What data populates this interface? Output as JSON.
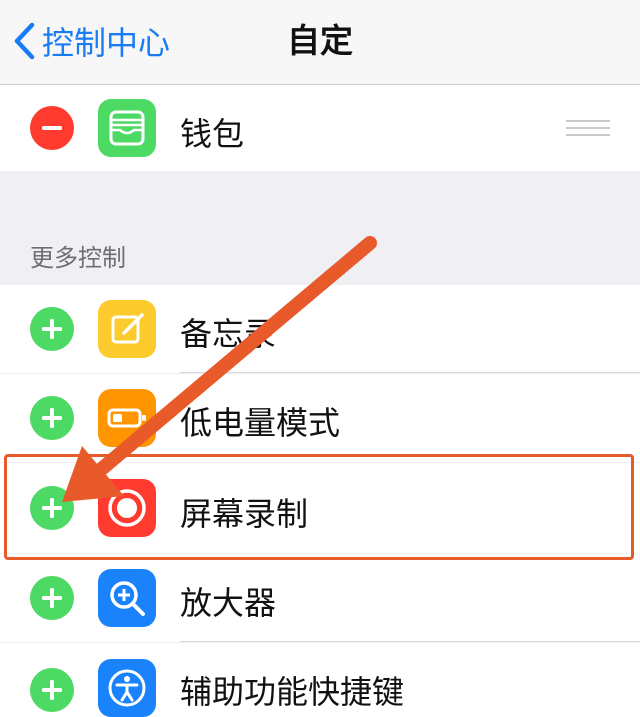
{
  "nav": {
    "back_label": "控制中心",
    "title": "自定"
  },
  "included": [
    {
      "label": "钱包",
      "icon": "wallet-icon",
      "color": "#4cd964"
    }
  ],
  "section_header": "更多控制",
  "more": [
    {
      "label": "备忘录",
      "icon": "notes-icon",
      "color": "#fecb2e"
    },
    {
      "label": "低电量模式",
      "icon": "battery-icon",
      "color": "#ff9500"
    },
    {
      "label": "屏幕录制",
      "icon": "screen-record-icon",
      "color": "#ff3b30"
    },
    {
      "label": "放大器",
      "icon": "magnifier-icon",
      "color": "#1a82fb"
    },
    {
      "label": "辅助功能快捷键",
      "icon": "accessibility-icon",
      "color": "#1a82fb"
    }
  ],
  "colors": {
    "accent": "#1a7cf5",
    "remove": "#ff3b30",
    "add": "#4cd964",
    "annotation": "#e85a2a"
  }
}
